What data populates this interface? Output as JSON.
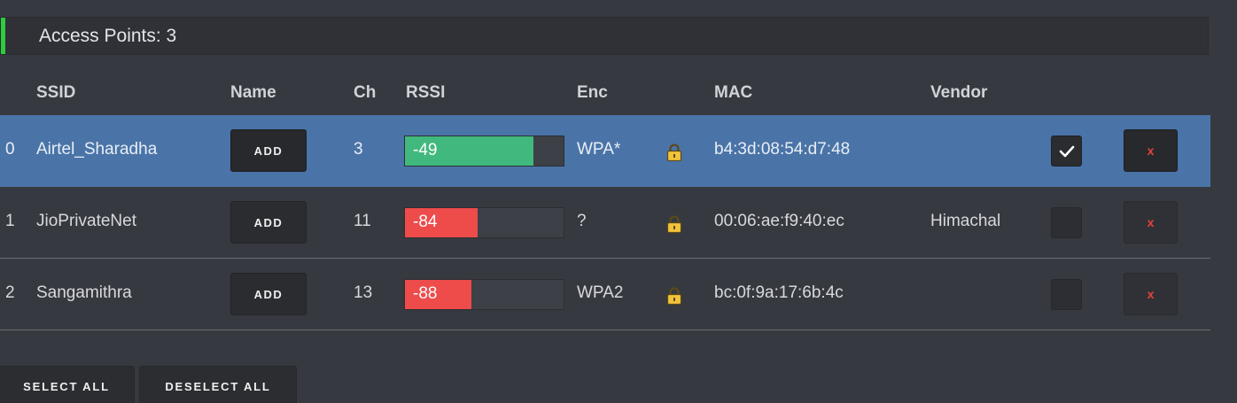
{
  "header": {
    "title": "Access Points: 3",
    "accent_color": "#2ecc40"
  },
  "columns": {
    "ssid": "SSID",
    "name": "Name",
    "ch": "Ch",
    "rssi": "RSSI",
    "enc": "Enc",
    "mac": "MAC",
    "vendor": "Vendor"
  },
  "rows": [
    {
      "index": "0",
      "ssid": "Airtel_Sharadha",
      "name_button": "ADD",
      "ch": "3",
      "rssi": "-49",
      "rssi_level": 0.81,
      "rssi_status": "good",
      "enc": "WPA*",
      "enc_icon": "lock-icon",
      "mac": "b4:3d:08:54:d7:48",
      "vendor": "",
      "checked": true,
      "selected": true,
      "delete_label": "x"
    },
    {
      "index": "1",
      "ssid": "JioPrivateNet",
      "name_button": "ADD",
      "ch": "11",
      "rssi": "-84",
      "rssi_level": 0.46,
      "rssi_status": "bad",
      "enc": "?",
      "enc_icon": "lock-icon",
      "mac": "00:06:ae:f9:40:ec",
      "vendor": "Himachal",
      "checked": false,
      "selected": false,
      "delete_label": "x"
    },
    {
      "index": "2",
      "ssid": "Sangamithra",
      "name_button": "ADD",
      "ch": "13",
      "rssi": "-88",
      "rssi_level": 0.42,
      "rssi_status": "bad",
      "enc": "WPA2",
      "enc_icon": "lock-icon",
      "mac": "bc:0f:9a:17:6b:4c",
      "vendor": "",
      "checked": false,
      "selected": false,
      "delete_label": "x"
    }
  ],
  "actions": {
    "select_all": "SELECT ALL",
    "deselect_all": "DESELECT ALL"
  },
  "colors": {
    "selected_row": "#4a74a8",
    "rssi_good": "#41b87d",
    "rssi_bad": "#ee4b4b",
    "delete": "#e5433d",
    "lock": "#f2c33a"
  }
}
